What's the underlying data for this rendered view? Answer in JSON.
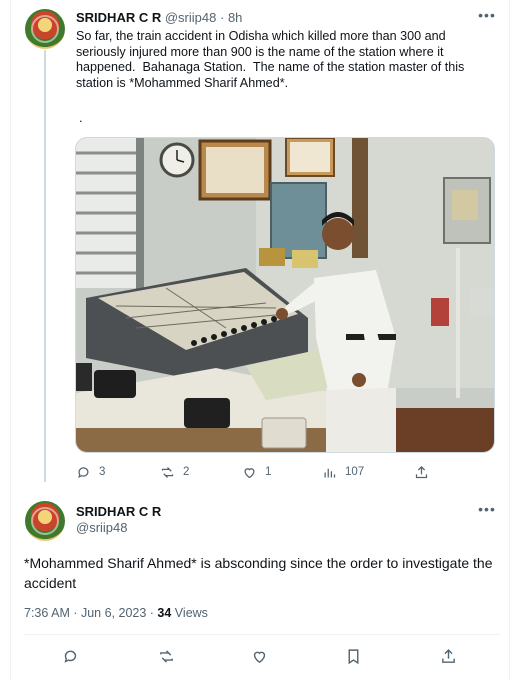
{
  "tweet1": {
    "author_name": "SRIDHAR C R",
    "author_handle": "@sriip48",
    "separator": "·",
    "time": "8h",
    "text_lines": [
      "So far, the train accident in Odisha which killed more than 300 and",
      "seriously injured more than 900 is the name of the station where it",
      "happened.  Bahanaga Station.  The name of the station master of this",
      "station is *Mohammed Sharif Ahmed*."
    ],
    "trailing": ".",
    "image_alt": "Man in white uniform standing beside a railway signalling control panel in a station office",
    "actions": {
      "replies": "3",
      "retweets": "2",
      "likes": "1",
      "views": "107"
    }
  },
  "tweet2": {
    "author_name": "SRIDHAR C R",
    "author_handle": "@sriip48",
    "text": "*Mohammed Sharif Ahmed* is absconding since the order to investigate the accident",
    "timestamp": "7:36 AM · Jun 6, 2023 · ",
    "views_count": "34",
    "views_label": " Views"
  },
  "icons": [
    "more-icon",
    "reply-icon",
    "retweet-icon",
    "like-icon",
    "views-icon",
    "share-icon",
    "bookmark-icon"
  ],
  "colors": {
    "text": "#0f1419",
    "muted": "#536471",
    "border": "#eff3f4",
    "thread_line": "#cfd9de"
  }
}
